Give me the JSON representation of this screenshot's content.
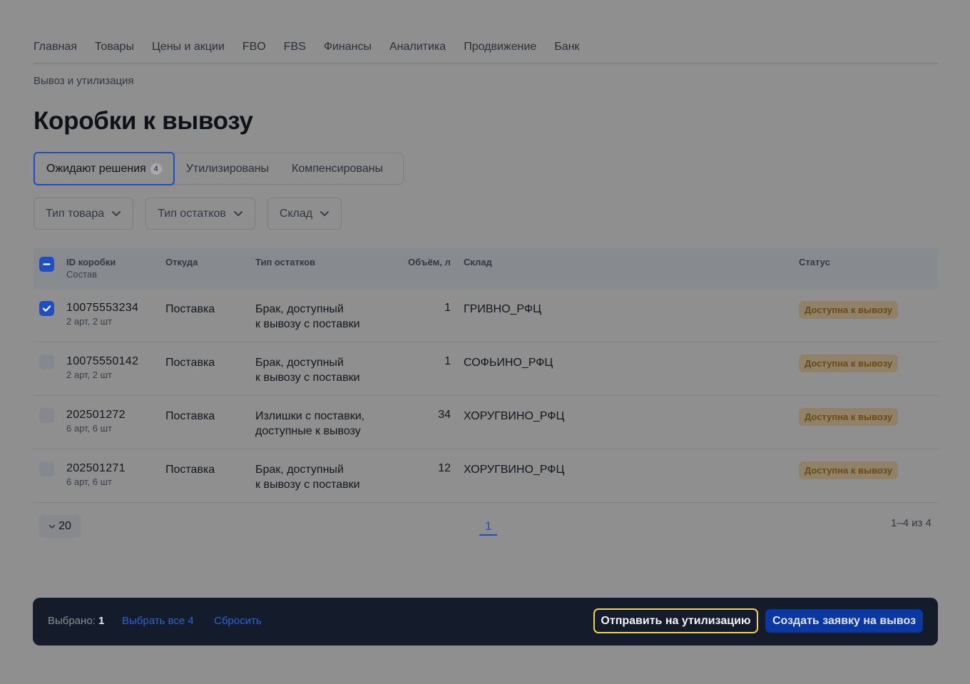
{
  "nav": {
    "items": [
      "Главная",
      "Товары",
      "Цены и акции",
      "FBO",
      "FBS",
      "Финансы",
      "Аналитика",
      "Продвижение",
      "Банк"
    ]
  },
  "breadcrumb": "Вывоз и утилизация",
  "title": "Коробки к вывозу",
  "tabs": [
    {
      "label": "Ожидают решения",
      "count": "4"
    },
    {
      "label": "Утилизированы"
    },
    {
      "label": "Компенсированы"
    }
  ],
  "filters": [
    "Тип товара",
    "Тип остатков",
    "Склад"
  ],
  "table": {
    "headers": {
      "id": "ID коробки",
      "id_sub": "Состав",
      "from": "Откуда",
      "type": "Тип остатков",
      "volume": "Объём, л",
      "warehouse": "Склад",
      "status": "Статус"
    },
    "rows": [
      {
        "id": "10075553234",
        "composition": "2 арт, 2 шт",
        "from": "Поставка",
        "type_line1": "Брак, доступный",
        "type_line2": "к вывозу с поставки",
        "volume": "1",
        "warehouse": "ГРИВНО_РФЦ",
        "status": "Доступна к вывозу",
        "checked": true
      },
      {
        "id": "10075550142",
        "composition": "2 арт, 2 шт",
        "from": "Поставка",
        "type_line1": "Брак, доступный",
        "type_line2": "к вывозу с поставки",
        "volume": "1",
        "warehouse": "СОФЬИНО_РФЦ",
        "status": "Доступна к вывозу",
        "checked": false
      },
      {
        "id": "202501272",
        "composition": "6 арт, 6 шт",
        "from": "Поставка",
        "type_line1": "Излишки с поставки,",
        "type_line2": "доступные к вывозу",
        "volume": "34",
        "warehouse": "ХОРУГВИНО_РФЦ",
        "status": "Доступна к вывозу",
        "checked": false
      },
      {
        "id": "202501271",
        "composition": "6 арт, 6 шт",
        "from": "Поставка",
        "type_line1": "Брак, доступный",
        "type_line2": "к вывозу с поставки",
        "volume": "12",
        "warehouse": "ХОРУГВИНО_РФЦ",
        "status": "Доступна к вывозу",
        "checked": false
      }
    ]
  },
  "pagination": {
    "per_page": "20",
    "current_page": "1",
    "range": "1–4 из 4"
  },
  "action_bar": {
    "selected_label": "Выбрано: ",
    "selected_count": "1",
    "select_all": "Выбрать все 4",
    "reset": "Сбросить",
    "utilize_button": "Отправить на утилизацию",
    "create_button": "Создать заявку на вывоз"
  },
  "colors": {
    "accent": "#1d4fc4",
    "overlay_bg": "#8f8f8f",
    "action_bar_bg": "#141b2a",
    "focus_outline": "#f2d34a",
    "badge_bg": "#8f8269",
    "badge_text": "#6b4a12"
  }
}
